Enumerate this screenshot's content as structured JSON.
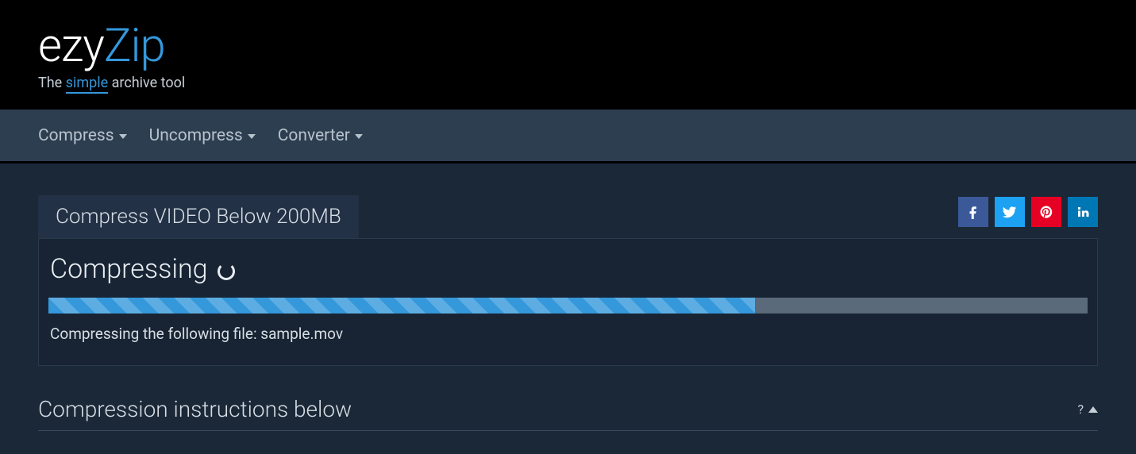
{
  "logo": {
    "part1": "ezy",
    "part2": "Zip",
    "tagline_pre": "The ",
    "tagline_mid": "simple",
    "tagline_post": " archive tool"
  },
  "nav": {
    "compress": "Compress",
    "uncompress": "Uncompress",
    "converter": "Converter"
  },
  "page": {
    "tab_title": "Compress VIDEO Below 200MB",
    "status": "Compressing",
    "progress_percent": 68,
    "file_line": "Compressing the following file: sample.mov",
    "instructions_heading": "Compression instructions below",
    "help_label": "?"
  },
  "social": {
    "facebook": "facebook",
    "twitter": "twitter",
    "pinterest": "pinterest",
    "linkedin": "linkedin"
  }
}
